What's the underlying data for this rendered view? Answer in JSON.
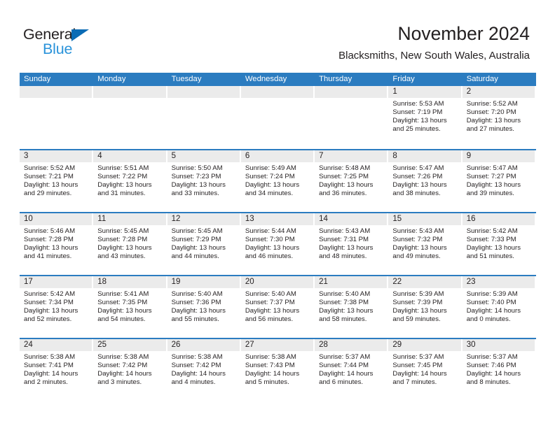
{
  "brand": {
    "name_part1": "General",
    "name_part2": "Blue",
    "accent_dark": "#0b6cb5",
    "accent_light": "#2a93da"
  },
  "header": {
    "title": "November 2024",
    "subtitle": "Blacksmiths, New South Wales, Australia"
  },
  "theme": {
    "header_bar": "#2b7cc0",
    "daynum_band": "#ebebeb",
    "text": "#231f20"
  },
  "weekdays": [
    "Sunday",
    "Monday",
    "Tuesday",
    "Wednesday",
    "Thursday",
    "Friday",
    "Saturday"
  ],
  "weeks": [
    [
      {
        "day": "",
        "empty": true
      },
      {
        "day": "",
        "empty": true
      },
      {
        "day": "",
        "empty": true
      },
      {
        "day": "",
        "empty": true
      },
      {
        "day": "",
        "empty": true
      },
      {
        "day": "1",
        "sunrise": "Sunrise: 5:53 AM",
        "sunset": "Sunset: 7:19 PM",
        "daylight1": "Daylight: 13 hours",
        "daylight2": "and 25 minutes."
      },
      {
        "day": "2",
        "sunrise": "Sunrise: 5:52 AM",
        "sunset": "Sunset: 7:20 PM",
        "daylight1": "Daylight: 13 hours",
        "daylight2": "and 27 minutes."
      }
    ],
    [
      {
        "day": "3",
        "sunrise": "Sunrise: 5:52 AM",
        "sunset": "Sunset: 7:21 PM",
        "daylight1": "Daylight: 13 hours",
        "daylight2": "and 29 minutes."
      },
      {
        "day": "4",
        "sunrise": "Sunrise: 5:51 AM",
        "sunset": "Sunset: 7:22 PM",
        "daylight1": "Daylight: 13 hours",
        "daylight2": "and 31 minutes."
      },
      {
        "day": "5",
        "sunrise": "Sunrise: 5:50 AM",
        "sunset": "Sunset: 7:23 PM",
        "daylight1": "Daylight: 13 hours",
        "daylight2": "and 33 minutes."
      },
      {
        "day": "6",
        "sunrise": "Sunrise: 5:49 AM",
        "sunset": "Sunset: 7:24 PM",
        "daylight1": "Daylight: 13 hours",
        "daylight2": "and 34 minutes."
      },
      {
        "day": "7",
        "sunrise": "Sunrise: 5:48 AM",
        "sunset": "Sunset: 7:25 PM",
        "daylight1": "Daylight: 13 hours",
        "daylight2": "and 36 minutes."
      },
      {
        "day": "8",
        "sunrise": "Sunrise: 5:47 AM",
        "sunset": "Sunset: 7:26 PM",
        "daylight1": "Daylight: 13 hours",
        "daylight2": "and 38 minutes."
      },
      {
        "day": "9",
        "sunrise": "Sunrise: 5:47 AM",
        "sunset": "Sunset: 7:27 PM",
        "daylight1": "Daylight: 13 hours",
        "daylight2": "and 39 minutes."
      }
    ],
    [
      {
        "day": "10",
        "sunrise": "Sunrise: 5:46 AM",
        "sunset": "Sunset: 7:28 PM",
        "daylight1": "Daylight: 13 hours",
        "daylight2": "and 41 minutes."
      },
      {
        "day": "11",
        "sunrise": "Sunrise: 5:45 AM",
        "sunset": "Sunset: 7:28 PM",
        "daylight1": "Daylight: 13 hours",
        "daylight2": "and 43 minutes."
      },
      {
        "day": "12",
        "sunrise": "Sunrise: 5:45 AM",
        "sunset": "Sunset: 7:29 PM",
        "daylight1": "Daylight: 13 hours",
        "daylight2": "and 44 minutes."
      },
      {
        "day": "13",
        "sunrise": "Sunrise: 5:44 AM",
        "sunset": "Sunset: 7:30 PM",
        "daylight1": "Daylight: 13 hours",
        "daylight2": "and 46 minutes."
      },
      {
        "day": "14",
        "sunrise": "Sunrise: 5:43 AM",
        "sunset": "Sunset: 7:31 PM",
        "daylight1": "Daylight: 13 hours",
        "daylight2": "and 48 minutes."
      },
      {
        "day": "15",
        "sunrise": "Sunrise: 5:43 AM",
        "sunset": "Sunset: 7:32 PM",
        "daylight1": "Daylight: 13 hours",
        "daylight2": "and 49 minutes."
      },
      {
        "day": "16",
        "sunrise": "Sunrise: 5:42 AM",
        "sunset": "Sunset: 7:33 PM",
        "daylight1": "Daylight: 13 hours",
        "daylight2": "and 51 minutes."
      }
    ],
    [
      {
        "day": "17",
        "sunrise": "Sunrise: 5:42 AM",
        "sunset": "Sunset: 7:34 PM",
        "daylight1": "Daylight: 13 hours",
        "daylight2": "and 52 minutes."
      },
      {
        "day": "18",
        "sunrise": "Sunrise: 5:41 AM",
        "sunset": "Sunset: 7:35 PM",
        "daylight1": "Daylight: 13 hours",
        "daylight2": "and 54 minutes."
      },
      {
        "day": "19",
        "sunrise": "Sunrise: 5:40 AM",
        "sunset": "Sunset: 7:36 PM",
        "daylight1": "Daylight: 13 hours",
        "daylight2": "and 55 minutes."
      },
      {
        "day": "20",
        "sunrise": "Sunrise: 5:40 AM",
        "sunset": "Sunset: 7:37 PM",
        "daylight1": "Daylight: 13 hours",
        "daylight2": "and 56 minutes."
      },
      {
        "day": "21",
        "sunrise": "Sunrise: 5:40 AM",
        "sunset": "Sunset: 7:38 PM",
        "daylight1": "Daylight: 13 hours",
        "daylight2": "and 58 minutes."
      },
      {
        "day": "22",
        "sunrise": "Sunrise: 5:39 AM",
        "sunset": "Sunset: 7:39 PM",
        "daylight1": "Daylight: 13 hours",
        "daylight2": "and 59 minutes."
      },
      {
        "day": "23",
        "sunrise": "Sunrise: 5:39 AM",
        "sunset": "Sunset: 7:40 PM",
        "daylight1": "Daylight: 14 hours",
        "daylight2": "and 0 minutes."
      }
    ],
    [
      {
        "day": "24",
        "sunrise": "Sunrise: 5:38 AM",
        "sunset": "Sunset: 7:41 PM",
        "daylight1": "Daylight: 14 hours",
        "daylight2": "and 2 minutes."
      },
      {
        "day": "25",
        "sunrise": "Sunrise: 5:38 AM",
        "sunset": "Sunset: 7:42 PM",
        "daylight1": "Daylight: 14 hours",
        "daylight2": "and 3 minutes."
      },
      {
        "day": "26",
        "sunrise": "Sunrise: 5:38 AM",
        "sunset": "Sunset: 7:42 PM",
        "daylight1": "Daylight: 14 hours",
        "daylight2": "and 4 minutes."
      },
      {
        "day": "27",
        "sunrise": "Sunrise: 5:38 AM",
        "sunset": "Sunset: 7:43 PM",
        "daylight1": "Daylight: 14 hours",
        "daylight2": "and 5 minutes."
      },
      {
        "day": "28",
        "sunrise": "Sunrise: 5:37 AM",
        "sunset": "Sunset: 7:44 PM",
        "daylight1": "Daylight: 14 hours",
        "daylight2": "and 6 minutes."
      },
      {
        "day": "29",
        "sunrise": "Sunrise: 5:37 AM",
        "sunset": "Sunset: 7:45 PM",
        "daylight1": "Daylight: 14 hours",
        "daylight2": "and 7 minutes."
      },
      {
        "day": "30",
        "sunrise": "Sunrise: 5:37 AM",
        "sunset": "Sunset: 7:46 PM",
        "daylight1": "Daylight: 14 hours",
        "daylight2": "and 8 minutes."
      }
    ]
  ]
}
